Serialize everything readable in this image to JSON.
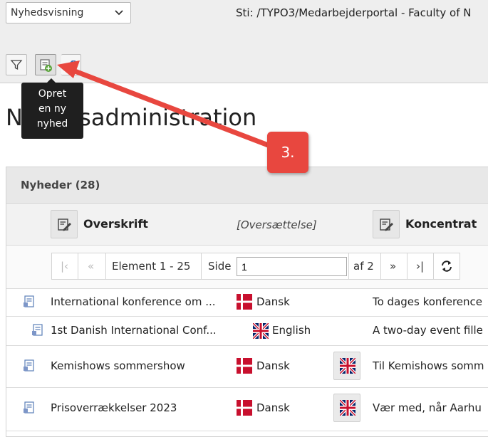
{
  "header": {
    "view_select": "Nyhedsvisning",
    "path": "Sti: /TYPO3/Medarbejderportal - Faculty of N"
  },
  "toolbar": {
    "tooltip_lines": [
      "Opret",
      "en ny",
      "nyhed"
    ]
  },
  "page": {
    "title": "Nyhedsadministration"
  },
  "panel": {
    "title": "Nyheder (28)",
    "columns": {
      "headline": "Overskrift",
      "translation": "[Oversættelse]",
      "teaser": "Koncentrat"
    }
  },
  "pager": {
    "range": "Element 1 - 25",
    "page_label": "Side",
    "page_value": "1",
    "of": "af 2"
  },
  "rows": [
    {
      "title": "International konference om ...",
      "language": "Dansk",
      "teaser": "To dages konference"
    },
    {
      "title": "1st Danish International Conf...",
      "language": "English",
      "teaser": "A two-day event fille"
    },
    {
      "title": "Kemishows sommershow",
      "language": "Dansk",
      "teaser": "Til Kemishows somm"
    },
    {
      "title": "Prisoverrækkelser 2023",
      "language": "Dansk",
      "teaser": "Vær med, når Aarhu"
    }
  ],
  "annotation": {
    "step": "3."
  },
  "colors": {
    "annotation_red": "#e8473f",
    "tooltip_bg": "#1f1f1f",
    "danish_red": "#c8102e",
    "uk_blue": "#012169"
  }
}
